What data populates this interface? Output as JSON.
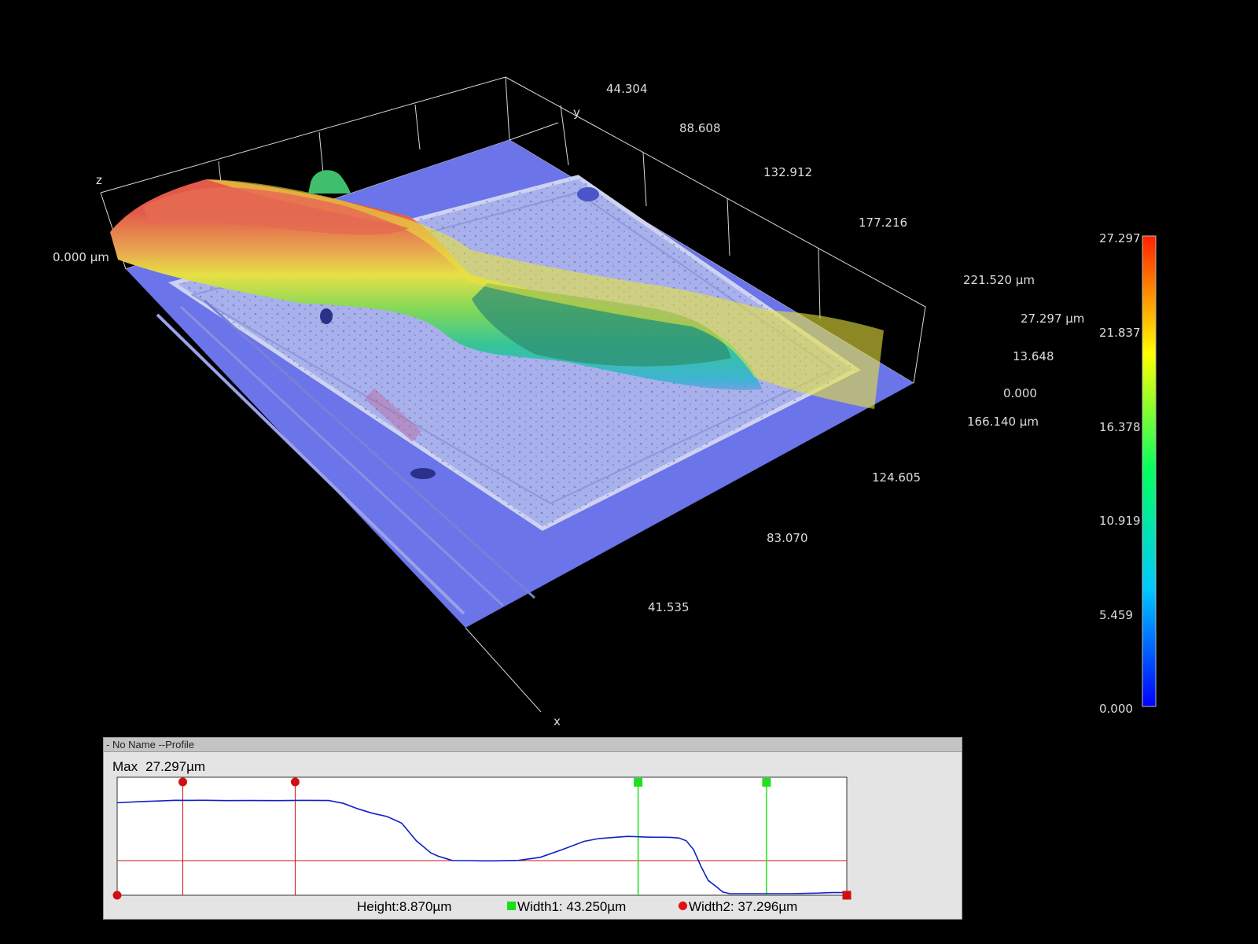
{
  "view3d": {
    "x_axis_title": "x",
    "y_axis_title": "y",
    "z_axis_title": "z",
    "y_ticks": [
      "44.304",
      "88.608",
      "132.912",
      "177.216",
      "221.520 µm"
    ],
    "x_ticks": [
      "41.535",
      "83.070",
      "124.605",
      "166.140 µm"
    ],
    "z_ticks": [
      "0.000",
      "13.648",
      "27.297 µm"
    ],
    "origin_label": "0.000 µm",
    "surface_colors": {
      "base": "#6b74e8",
      "pad": "#a9b1ec",
      "peak": "#e86848",
      "plateau": "#e7e33a",
      "valley": "#3aa66b"
    }
  },
  "colorbar": {
    "min": 0.0,
    "max": 27.297,
    "labels": [
      "27.297",
      "21.837",
      "16.378",
      "10.919",
      "5.459",
      "0.000"
    ],
    "colormap": [
      "#0000ff",
      "#00c8ff",
      "#00ff60",
      "#ffff00",
      "#ff2000"
    ]
  },
  "profile": {
    "window_title": "- No Name --Profile",
    "max_label": "Max",
    "max_value": "27.297µm",
    "height_label": "Height:",
    "height_value": "8.870µm",
    "width1_label": "Width1:",
    "width1_value": "43.250µm",
    "width2_label": "Width2:",
    "width2_value": "37.296µm",
    "line_color": "#1020c8",
    "height_cursor_color": "#d01010",
    "width_cursor_color": "#20e020"
  },
  "chart_data": {
    "type": "line",
    "title": "",
    "xlabel": "",
    "ylabel": "",
    "xlim": [
      0,
      100
    ],
    "ylim": [
      0,
      1
    ],
    "series": [
      {
        "x": [
          0,
          3,
          6,
          8,
          10,
          12,
          15,
          18,
          22,
          26,
          29,
          31,
          33,
          35,
          37,
          39,
          41,
          43,
          44,
          45,
          46,
          48,
          50,
          52,
          55,
          58,
          61,
          64,
          66,
          68,
          70,
          71,
          72,
          73,
          74,
          75,
          76,
          77,
          78,
          79,
          80,
          81,
          82,
          83,
          84,
          86,
          88,
          90,
          92,
          94,
          96,
          98,
          100
        ],
        "y": [
          0.825,
          0.835,
          0.842,
          0.848,
          0.847,
          0.848,
          0.845,
          0.846,
          0.845,
          0.847,
          0.846,
          0.82,
          0.77,
          0.73,
          0.7,
          0.64,
          0.48,
          0.37,
          0.34,
          0.32,
          0.3,
          0.3,
          0.298,
          0.298,
          0.302,
          0.33,
          0.4,
          0.475,
          0.5,
          0.51,
          0.52,
          0.518,
          0.515,
          0.513,
          0.512,
          0.512,
          0.51,
          0.505,
          0.48,
          0.4,
          0.25,
          0.12,
          0.07,
          0.015,
          0.0,
          0.0,
          0.0,
          0.0,
          0.0,
          0.002,
          0.005,
          0.01,
          0.01
        ]
      }
    ],
    "height_cursors_x": [
      9,
      24.4
    ],
    "width_cursors_x": [
      71.4,
      89
    ],
    "reference_level_y": 0.3,
    "endpoint_markers_x": [
      0,
      100
    ]
  }
}
